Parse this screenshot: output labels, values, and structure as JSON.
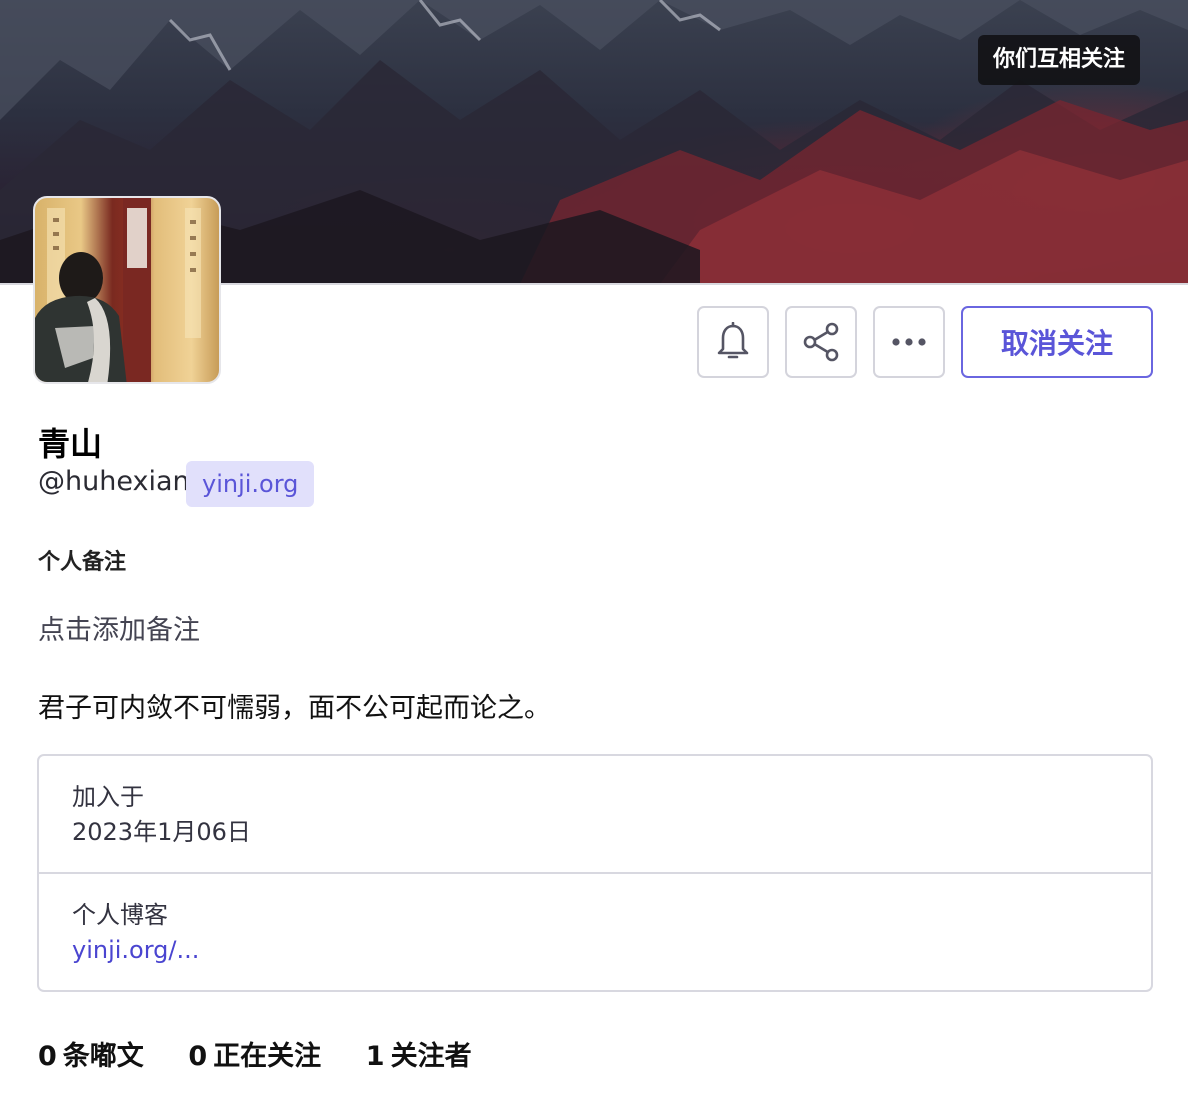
{
  "profile": {
    "mutual_badge": "你们互相关注",
    "display_name": "青山",
    "acct": "@huhexian",
    "domain": "yinji.org",
    "note_label": "个人备注",
    "note_placeholder": "点击添加备注",
    "bio": "君子可内敛不可懦弱，面不公可起而论之。"
  },
  "actions": {
    "bell_icon": "bell-icon",
    "share_icon": "share-icon",
    "more_icon": "more-horizontal-icon",
    "unfollow_label": "取消关注"
  },
  "fields": [
    {
      "name": "加入于",
      "value": "2023年1月06日"
    },
    {
      "name": "个人博客",
      "value": "yinji.org/..."
    }
  ],
  "stats": [
    {
      "count": "0",
      "label": "条嘟文"
    },
    {
      "count": "0",
      "label": "正在关注"
    },
    {
      "count": "1",
      "label": "关注者"
    }
  ],
  "colors": {
    "accent": "#5a55d8",
    "domain_badge_bg": "#e1e0fb",
    "border": "#d8d8e0"
  }
}
